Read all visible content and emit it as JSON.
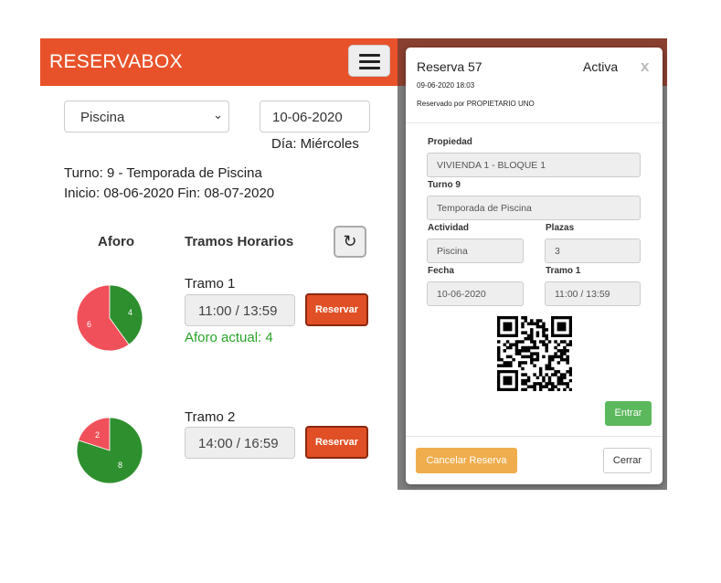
{
  "app": {
    "brand": "RESERVABOX"
  },
  "filters": {
    "facility": "Piscina",
    "date": "10-06-2020",
    "day_label": "Día: Miércoles"
  },
  "turno": {
    "line1": "Turno: 9 - Temporada de Piscina",
    "line2": "Inicio: 08-06-2020 Fin: 08-07-2020"
  },
  "headers": {
    "aforo": "Aforo",
    "tramos": "Tramos Horarios"
  },
  "slots": [
    {
      "label": "Tramo 1",
      "time": "11:00 / 13:59",
      "button": "Reservar",
      "aforo_text": "Aforo actual: 4",
      "occupied": 4,
      "free": 6,
      "occupied_color": "#2e8f2e",
      "free_color": "#f0505a"
    },
    {
      "label": "Tramo 2",
      "time": "14:00 / 16:59",
      "button": "Reservar",
      "aforo_text": "",
      "occupied": 8,
      "free": 2,
      "occupied_color": "#2e8f2e",
      "free_color": "#f0505a"
    }
  ],
  "modal": {
    "title": "Reserva 57",
    "status": "Activa",
    "close": "x",
    "datetime": "09-06-2020 18:03",
    "reserved_by": "Reservado por PROPIETARIO UNO",
    "propiedad_label": "Propiedad",
    "propiedad_value": "VIVIENDA 1 - BLOQUE 1",
    "turno_label": "Turno 9",
    "turno_value": "Temporada de Piscina",
    "actividad_label": "Actividad",
    "actividad_value": "Piscina",
    "plazas_label": "Plazas",
    "plazas_value": "3",
    "fecha_label": "Fecha",
    "fecha_value": "10-06-2020",
    "tramo_label": "Tramo 1",
    "tramo_value": "11:00 / 13:59",
    "entrar": "Entrar",
    "cancelar": "Cancelar Reserva",
    "cerrar": "Cerrar"
  },
  "icons": {
    "menu": "hamburger-icon",
    "refresh": "refresh-icon",
    "select": "chevron-down-icon",
    "qr": "qr-code-icon"
  }
}
